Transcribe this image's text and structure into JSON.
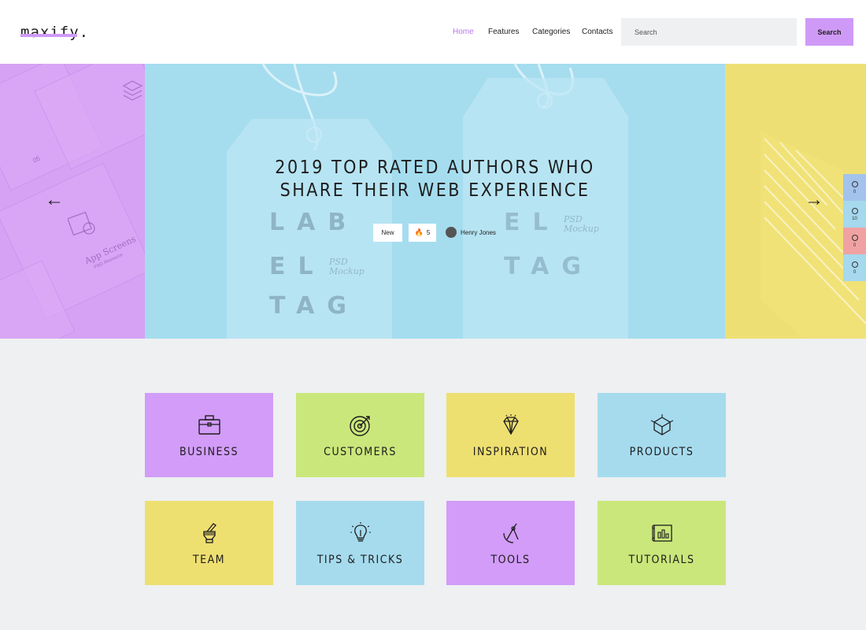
{
  "logo": "maxify.",
  "nav": {
    "items": [
      {
        "label": "Home",
        "active": true
      },
      {
        "label": "Features",
        "active": false
      },
      {
        "label": "Categories",
        "active": false
      },
      {
        "label": "Contacts",
        "active": false
      }
    ]
  },
  "search": {
    "placeholder": "Search",
    "button_label": "Search"
  },
  "hero": {
    "title_line1": "2019 TOP RATED AUTHORS WHO",
    "title_line2": "SHARE THEIR WEB EXPERIENCE",
    "badge_new": "New",
    "likes": "5",
    "author": "Henry Jones",
    "tag_text_a": "LAB",
    "tag_text_b": "EL",
    "tag_text_c": "TAG",
    "tag_sub": "PSD Mockup",
    "left_card_number": "05",
    "left_card_title": "App Screens",
    "left_card_subtitle": "PSD Resource"
  },
  "social": [
    {
      "icon": "facebook-icon",
      "count": "0",
      "color": "#a3c3ec"
    },
    {
      "icon": "pinterest-icon",
      "count": "10",
      "color": "#a6d8ee"
    },
    {
      "icon": "google-plus-icon",
      "count": "0",
      "color": "#f0a2a2"
    },
    {
      "icon": "mail-icon",
      "count": "0",
      "color": "#a6d8ee"
    }
  ],
  "categories": [
    {
      "label": "BUSINESS",
      "icon": "briefcase-icon",
      "color": "#d29cf8"
    },
    {
      "label": "CUSTOMERS",
      "icon": "target-icon",
      "color": "#cae77b"
    },
    {
      "label": "INSPIRATION",
      "icon": "diamond-icon",
      "color": "#eedf71"
    },
    {
      "label": "PRODUCTS",
      "icon": "cube-icon",
      "color": "#a6dbee"
    },
    {
      "label": "TEAM",
      "icon": "hand-pen-icon",
      "color": "#eedf71"
    },
    {
      "label": "TIPS & TRICKS",
      "icon": "lightbulb-icon",
      "color": "#a6dbee"
    },
    {
      "label": "TOOLS",
      "icon": "compass-icon",
      "color": "#d29cf8"
    },
    {
      "label": "TUTORIALS",
      "icon": "blueprint-icon",
      "color": "#cae77b"
    }
  ]
}
